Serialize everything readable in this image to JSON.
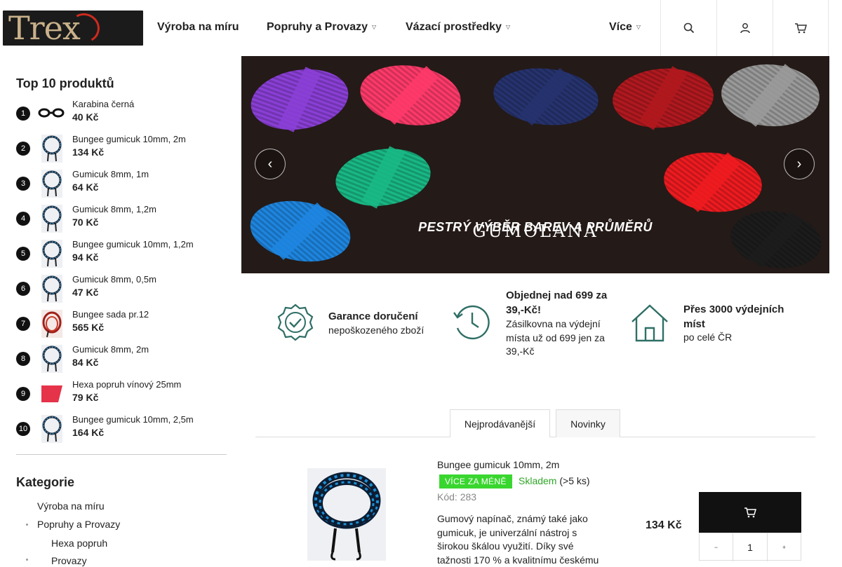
{
  "header": {
    "logo_text": "Trex mat",
    "nav": [
      {
        "label": "Výroba na míru",
        "dropdown": false
      },
      {
        "label": "Popruhy a Provazy",
        "dropdown": true
      },
      {
        "label": "Vázací prostředky",
        "dropdown": true
      },
      {
        "label": "Více",
        "dropdown": true
      }
    ],
    "icons": [
      "search-icon",
      "user-icon",
      "cart-icon"
    ]
  },
  "sidebar": {
    "top_title": "Top 10 produktů",
    "top_items": [
      {
        "rank": "1",
        "name": "Karabina černá",
        "price": "40 Kč",
        "thumb": "carabiner"
      },
      {
        "rank": "2",
        "name": "Bungee gumicuk 10mm, 2m",
        "price": "134 Kč",
        "thumb": "cord"
      },
      {
        "rank": "3",
        "name": "Gumicuk 8mm, 1m",
        "price": "64 Kč",
        "thumb": "cord"
      },
      {
        "rank": "4",
        "name": "Gumicuk 8mm, 1,2m",
        "price": "70 Kč",
        "thumb": "cord"
      },
      {
        "rank": "5",
        "name": "Bungee gumicuk 10mm, 1,2m",
        "price": "94 Kč",
        "thumb": "cord"
      },
      {
        "rank": "6",
        "name": "Gumicuk 8mm, 0,5m",
        "price": "47 Kč",
        "thumb": "cord"
      },
      {
        "rank": "7",
        "name": "Bungee sada pr.12",
        "price": "565 Kč",
        "thumb": "set"
      },
      {
        "rank": "8",
        "name": "Gumicuk 8mm, 2m",
        "price": "84 Kč",
        "thumb": "cord"
      },
      {
        "rank": "9",
        "name": "Hexa popruh vínový 25mm",
        "price": "79 Kč",
        "thumb": "strap"
      },
      {
        "rank": "10",
        "name": "Bungee gumicuk 10mm, 2,5m",
        "price": "164 Kč",
        "thumb": "cord"
      }
    ],
    "categories_title": "Kategorie",
    "categories": [
      {
        "label": "Výroba na míru",
        "level": 0,
        "bullet": false
      },
      {
        "label": "Popruhy a Provazy",
        "level": 0,
        "bullet": true
      },
      {
        "label": "Hexa popruh",
        "level": 1,
        "bullet": false
      },
      {
        "label": "Provazy",
        "level": 1,
        "bullet": true
      }
    ]
  },
  "banner": {
    "title": "GUMOLANA",
    "subtitle": "PESTRÝ VÝBĚR BAREV A PRŮMĚRŮ",
    "prev_icon": "chevron-left-icon",
    "next_icon": "chevron-right-icon",
    "cord_colors": [
      "#8a3fd6",
      "#ff3a6a",
      "#26336f",
      "#b1191f",
      "#9a9a9a",
      "#19b885",
      "#ef1b20",
      "#1e86e0",
      "#1c1c1c"
    ]
  },
  "benefits": [
    {
      "icon": "badge-check-icon",
      "title": "Garance doručení",
      "text": "nepoškozeného zboží"
    },
    {
      "icon": "clock-history-icon",
      "title": "Objednej nad 699 za 39,-Kč!",
      "text": "Zásilkovna na výdejní místa už od 699 jen za 39,-Kč"
    },
    {
      "icon": "home-icon",
      "title": "Přes 3000 výdejních míst",
      "text": "po celé ČR"
    }
  ],
  "tabs": [
    {
      "label": "Nejprodávanější",
      "active": true
    },
    {
      "label": "Novinky",
      "active": false
    }
  ],
  "product": {
    "name": "Bungee gumicuk 10mm, 2m",
    "badge": "VÍCE ZA MÉNĚ",
    "stock_status": "Skladem",
    "stock_count": "(>5 ks)",
    "code": "Kód: 283",
    "description": "Gumový napínač, známý také jako gumicuk, je univerzální nástroj s širokou škálou využití. Díky své tažnosti 170 % a kvalitnímu českému",
    "price": "134 Kč",
    "quantity": "1",
    "cart_icon": "cart-add-icon"
  },
  "colors": {
    "accent_green": "#39d62f",
    "stock_green": "#2fa528",
    "dark": "#111111"
  }
}
